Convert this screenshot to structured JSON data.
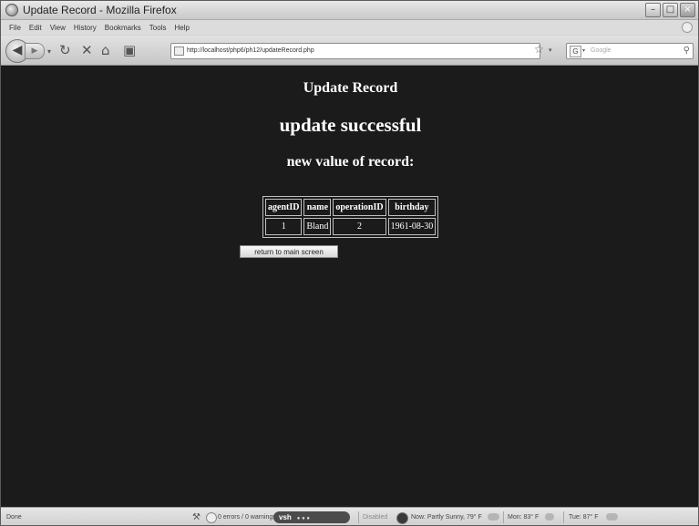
{
  "window": {
    "title": "Update Record - Mozilla Firefox",
    "minimize_glyph": "–",
    "maximize_glyph": "□",
    "close_glyph": "×"
  },
  "menu": [
    "File",
    "Edit",
    "View",
    "History",
    "Bookmarks",
    "Tools",
    "Help"
  ],
  "nav": {
    "url": "http://localhost/php6/ph12/updateRecord.php",
    "search_placeholder": "Google",
    "search_engine_letter": "G"
  },
  "page": {
    "heading_small": "Update Record",
    "heading_main": "update successful",
    "heading_sub": "new value of record:",
    "table": {
      "headers": [
        "agentID",
        "name",
        "operationID",
        "birthday"
      ],
      "rows": [
        [
          "1",
          "Bland",
          "2",
          "1961-08-30"
        ]
      ]
    },
    "return_button": "return to main screen"
  },
  "status": {
    "left": "Done",
    "errors": "0 errors / 0 warnings",
    "vsh_label": "vsh",
    "vsh_dots": "●  ●  ●",
    "disabled": "Disabled",
    "weather_now": "Now: Partly Sunny, 79° F",
    "weather_mon": "Mon: 83° F",
    "weather_tue": "Tue: 87° F"
  },
  "colors": {
    "page_background": "#1c1b1b",
    "page_text": "#ffffff",
    "chrome": "#d4d4d4"
  }
}
